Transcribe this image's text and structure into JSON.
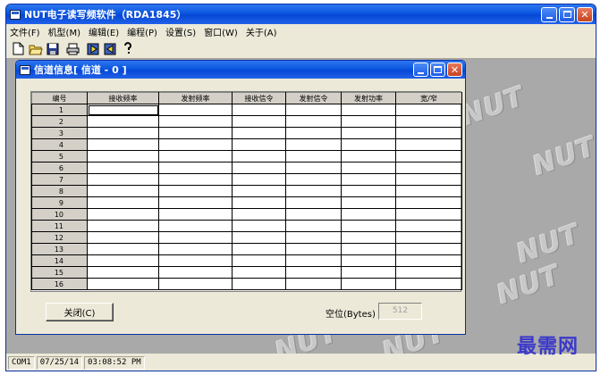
{
  "main_window": {
    "title": "NUT电子读写频软件（RDA1845）",
    "menu": [
      "文件(F)",
      "机型(M)",
      "编辑(E)",
      "编程(P)",
      "设置(S)",
      "窗口(W)",
      "关于(A)"
    ]
  },
  "toolbar": {
    "icons": [
      "new-file-icon",
      "open-folder-icon",
      "save-icon",
      "print-icon",
      "read-radio-icon",
      "write-radio-icon",
      "help-icon"
    ]
  },
  "dialog": {
    "title": "信道信息[ 信道 - 0 ]",
    "columns": [
      "编号",
      "接收频率",
      "发射频率",
      "接收信令",
      "发射信令",
      "发射功率",
      "宽/窄"
    ],
    "rows": [
      "1",
      "2",
      "3",
      "4",
      "5",
      "6",
      "7",
      "8",
      "9",
      "10",
      "11",
      "12",
      "13",
      "14",
      "15",
      "16"
    ],
    "close_label": "关闭(C)",
    "free_label": "空位(Bytes)",
    "free_value": "512"
  },
  "watermark": {
    "text": "NUT"
  },
  "status": {
    "port": "COM1",
    "date": "07/25/14",
    "time": "03:08:52 PM"
  },
  "site_brand": "最需网",
  "colors": {
    "titlebar": "#0b56e0",
    "desktop": "#a9a9a9",
    "dialog_bg": "#ece9d8",
    "brand": "#3b39c9"
  }
}
